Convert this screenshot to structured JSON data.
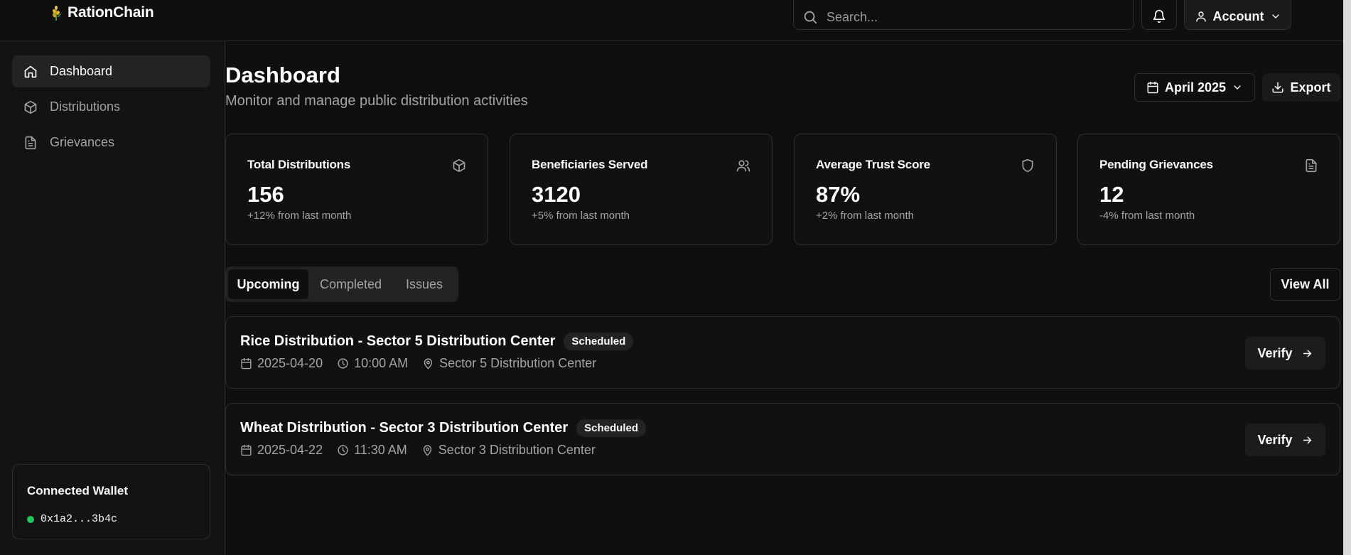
{
  "app": {
    "name": "RationChain",
    "logo_icon": "wheat-icon"
  },
  "header": {
    "search_placeholder": "Search...",
    "notifications_icon": "bell-icon",
    "account_label": "Account"
  },
  "sidebar": {
    "items": [
      {
        "label": "Dashboard",
        "icon": "home-icon",
        "active": true
      },
      {
        "label": "Distributions",
        "icon": "package-icon",
        "active": false
      },
      {
        "label": "Grievances",
        "icon": "file-text-icon",
        "active": false
      }
    ],
    "wallet": {
      "title": "Connected Wallet",
      "address": "0x1a2...3b4c",
      "status_color": "#22c55e"
    }
  },
  "main": {
    "title": "Dashboard",
    "subtitle": "Monitor and manage public distribution activities",
    "period_label": "April 2025",
    "export_label": "Export",
    "stats": [
      {
        "label": "Total Distributions",
        "value": "156",
        "change": "+12% from last month",
        "icon": "package-icon"
      },
      {
        "label": "Beneficiaries Served",
        "value": "3120",
        "change": "+5% from last month",
        "icon": "users-icon"
      },
      {
        "label": "Average Trust Score",
        "value": "87%",
        "change": "+2% from last month",
        "icon": "shield-icon"
      },
      {
        "label": "Pending Grievances",
        "value": "12",
        "change": "-4% from last month",
        "icon": "file-text-icon"
      }
    ],
    "tabs": [
      {
        "label": "Upcoming",
        "active": true
      },
      {
        "label": "Completed",
        "active": false
      },
      {
        "label": "Issues",
        "active": false
      }
    ],
    "view_all_label": "View All",
    "distributions": [
      {
        "title": "Rice Distribution - Sector 5 Distribution Center",
        "status": "Scheduled",
        "date": "2025-04-20",
        "time": "10:00 AM",
        "location": "Sector 5 Distribution Center",
        "action_label": "Verify"
      },
      {
        "title": "Wheat Distribution - Sector 3 Distribution Center",
        "status": "Scheduled",
        "date": "2025-04-22",
        "time": "11:30 AM",
        "location": "Sector 3 Distribution Center",
        "action_label": "Verify"
      }
    ]
  }
}
